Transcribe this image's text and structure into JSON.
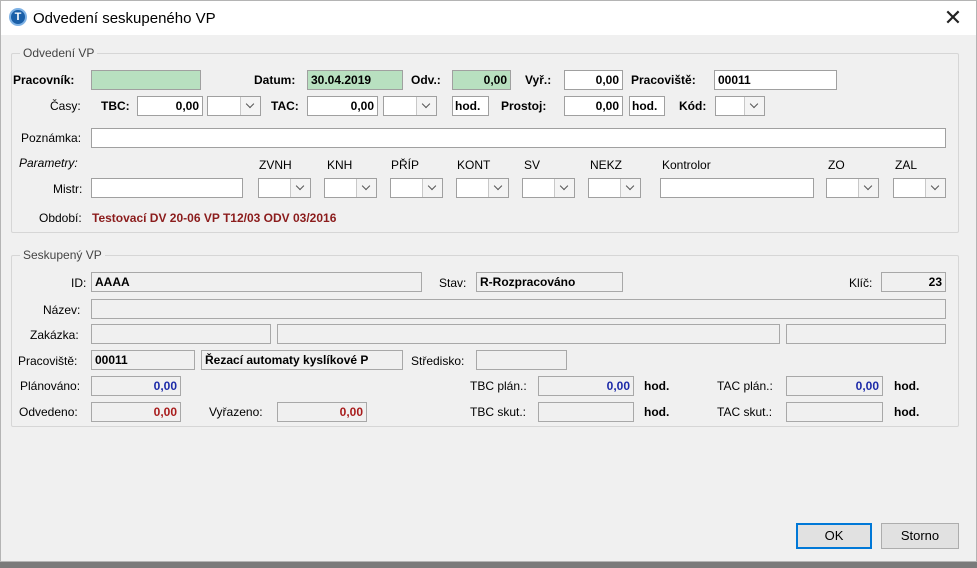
{
  "window": {
    "title": "Odvedení seskupeného VP",
    "close_symbol": "✕",
    "app_icon_letter": "T"
  },
  "odvedeni": {
    "group_title": "Odvedení VP",
    "pracovnik_label": "Pracovník:",
    "pracovnik_value": "",
    "datum_label": "Datum:",
    "datum_value": "30.04.2019",
    "odv_label": "Odv.:",
    "odv_value": "0,00",
    "vyr_label": "Vyř.:",
    "vyr_value": "0,00",
    "pracoviste_label": "Pracoviště:",
    "pracoviste_value": "00011",
    "casy_label": "Časy:",
    "tbc_label": "TBC:",
    "tbc_value": "0,00",
    "tac_label": "TAC:",
    "tac_value": "0,00",
    "hod_label": "hod.",
    "prostoj_label": "Prostoj:",
    "prostoj_value": "0,00",
    "prostoj_hod_label": "hod.",
    "kod_label": "Kód:",
    "poznamka_label": "Poznámka:",
    "poznamka_value": "",
    "parametry_label": "Parametry:",
    "mistr_label": "Mistr:",
    "mistr_value": "",
    "param_headers": {
      "zvnh": "ZVNH",
      "knh": "KNH",
      "prip": "PŘÍP",
      "kont": "KONT",
      "sv": "SV",
      "nekz": "NEKZ",
      "kontrolor": "Kontrolor",
      "zo": "ZO",
      "zal": "ZAL"
    },
    "kontrolor_value": "",
    "obdobi_label": "Období:",
    "obdobi_value": "Testovací DV 20-06 VP T12/03 ODV 03/2016"
  },
  "seskupeny": {
    "group_title": "Seskupený VP",
    "id_label": "ID:",
    "id_value": "AAAA",
    "stav_label": "Stav:",
    "stav_value": "R-Rozpracováno",
    "klic_label": "Klíč:",
    "klic_value": "23",
    "nazev_label": "Název:",
    "nazev_value": "",
    "zakazka_label": "Zakázka:",
    "zakazka_value1": "",
    "zakazka_value2": "",
    "zakazka_value3": "",
    "pracoviste_label": "Pracoviště:",
    "pracoviste_code": "00011",
    "pracoviste_name": "Řezací automaty kyslíkové P",
    "stredisko_label": "Středisko:",
    "stredisko_value": "",
    "planovano_label": "Plánováno:",
    "planovano_value": "0,00",
    "odvedeno_label": "Odvedeno:",
    "odvedeno_value": "0,00",
    "vyrazeno_label": "Vyřazeno:",
    "vyrazeno_value": "0,00",
    "tbc_plan_label": "TBC plán.:",
    "tbc_plan_value": "0,00",
    "tbc_skut_label": "TBC skut.:",
    "tbc_skut_value": "",
    "tac_plan_label": "TAC plán.:",
    "tac_plan_value": "0,00",
    "tac_skut_label": "TAC skut.:",
    "tac_skut_value": "",
    "hod_label": "hod."
  },
  "buttons": {
    "ok": "OK",
    "storno": "Storno"
  },
  "colors": {
    "green_field": "#b8e0c0",
    "dark_red_text": "#8b1c1c",
    "blue_value": "#1c2aa8",
    "accent": "#0078d7"
  }
}
